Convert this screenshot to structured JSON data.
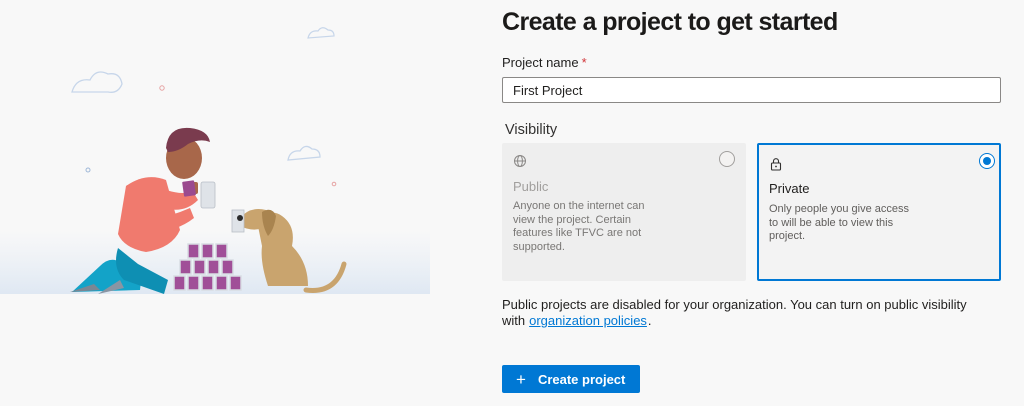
{
  "page": {
    "title": "Create a project to get started"
  },
  "project_name": {
    "label": "Project name",
    "required_marker": "*",
    "value": "First Project"
  },
  "visibility": {
    "label": "Visibility",
    "options": [
      {
        "title": "Public",
        "icon": "globe-icon",
        "description": "Anyone on the internet can view the project. Certain features like TFVC are not supported.",
        "selected": false,
        "disabled": true
      },
      {
        "title": "Private",
        "icon": "lock-icon",
        "description": "Only people you give access to will be able to view this project.",
        "selected": true,
        "disabled": false
      }
    ]
  },
  "note": {
    "text_before": "Public projects are disabled for your organization. You can turn on public visibility with",
    "link_text": "organization policies",
    "text_after": "."
  },
  "create_button": {
    "icon": "plus-icon",
    "label": "Create project"
  },
  "colors": {
    "accent": "#0078d4",
    "required": "#d13438",
    "background": "#f8f8f8"
  }
}
